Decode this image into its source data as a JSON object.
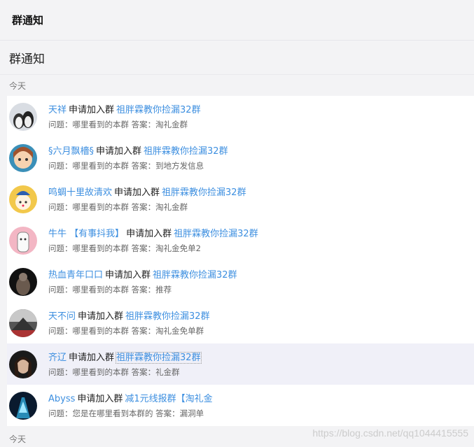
{
  "header": {
    "title": "群通知"
  },
  "page": {
    "title": "群通知"
  },
  "sections": [
    {
      "label": "今天"
    },
    {
      "label": "今天"
    }
  ],
  "requests": [
    {
      "name": "天祥",
      "action": "申请加入群",
      "group": "祖胖霖教你捡漏32群",
      "question_label": "问题：",
      "question": "哪里看到的本群",
      "answer_label": "答案：",
      "answer": "淘礼金群"
    },
    {
      "name": "§六月飘檣§",
      "action": "申请加入群",
      "group": "祖胖霖教你捡漏32群",
      "question_label": "问题：",
      "question": "哪里看到的本群",
      "answer_label": "答案：",
      "answer": "到地方发信息"
    },
    {
      "name": "鸣蜩十里故清欢",
      "action": "申请加入群",
      "group": "祖胖霖教你捡漏32群",
      "question_label": "问题：",
      "question": "哪里看到的本群",
      "answer_label": "答案：",
      "answer": "淘礼金群"
    },
    {
      "name": "牛牛 【有事抖我】",
      "action": "申请加入群",
      "group": "祖胖霖教你捡漏32群",
      "question_label": "问题：",
      "question": "哪里看到的本群",
      "answer_label": "答案：",
      "answer": "淘礼金免单2"
    },
    {
      "name": "热血青年口口",
      "action": "申请加入群",
      "group": "祖胖霖教你捡漏32群",
      "question_label": "问题：",
      "question": "哪里看到的本群",
      "answer_label": "答案：",
      "answer": "推荐"
    },
    {
      "name": "天不问",
      "action": "申请加入群",
      "group": "祖胖霖教你捡漏32群",
      "question_label": "问题：",
      "question": "哪里看到的本群",
      "answer_label": "答案：",
      "answer": "淘礼金免单群"
    },
    {
      "name": "齐辽",
      "action": "申请加入群",
      "group": "祖胖霖教你捡漏32群",
      "question_label": "问题：",
      "question": "哪里看到的本群",
      "answer_label": "答案：",
      "answer": "礼金群"
    },
    {
      "name": "Abyss",
      "action": "申请加入群",
      "group": "减1元线报群【淘礼金",
      "question_label": "问题：",
      "question": "您是在哪里看到本群的",
      "answer_label": "答案：",
      "answer": "漏洞单"
    }
  ],
  "watermark": "https://blog.csdn.net/qq1044415555",
  "colors": {
    "link": "#3d8fe0",
    "highlight_row": "#f0f0f8"
  }
}
